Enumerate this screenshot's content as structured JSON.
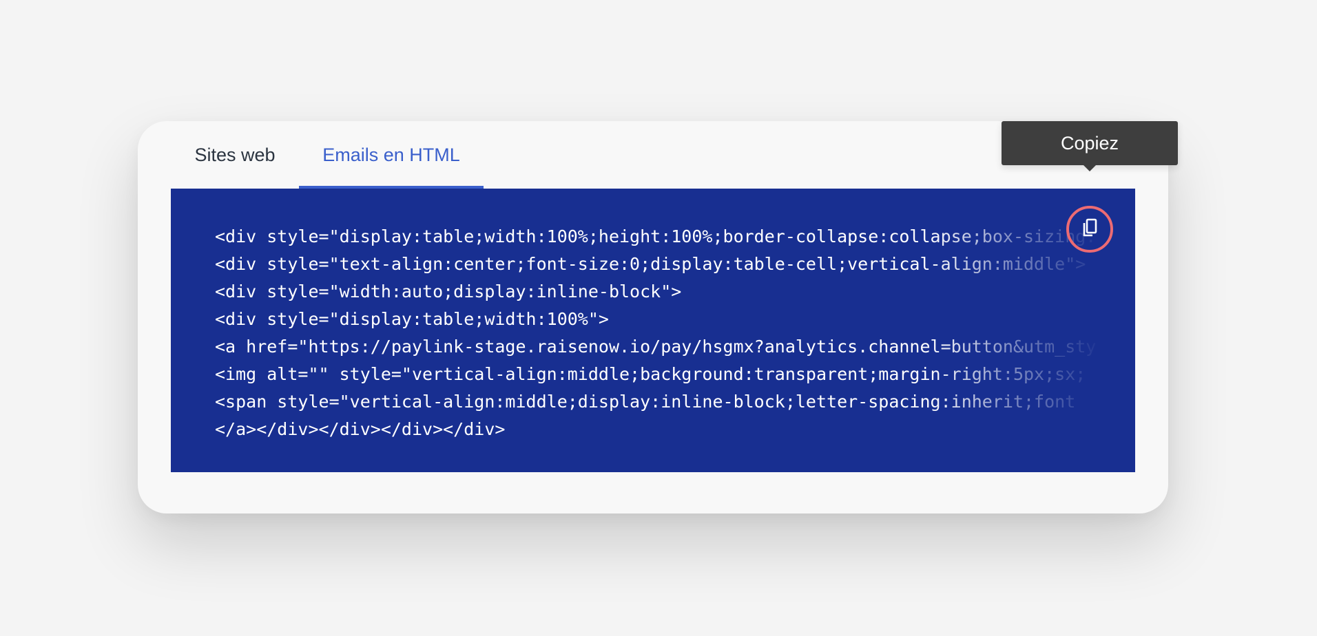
{
  "tabs": [
    {
      "label": "Sites web",
      "active": false
    },
    {
      "label": "Emails en HTML",
      "active": true
    }
  ],
  "code": {
    "lines": [
      "<div style=\"display:table;width:100%;height:100%;border-collapse:collapse;box-sizing:",
      "<div style=\"text-align:center;font-size:0;display:table-cell;vertical-align:middle\">",
      "<div style=\"width:auto;display:inline-block\">",
      "<div style=\"display:table;width:100%\">",
      "<a href=\"https://paylink-stage.raisenow.io/pay/hsgmx?analytics.channel=button&utm_sty",
      "<img alt=\"\" style=\"vertical-align:middle;background:transparent;margin-right:5px;sx;",
      "<span style=\"vertical-align:middle;display:inline-block;letter-spacing:inherit;font",
      "</a></div></div></div></div>"
    ]
  },
  "copy_button": {
    "icon": "copy-icon"
  },
  "tooltip": {
    "label": "Copiez"
  },
  "colors": {
    "background": "#f4f4f4",
    "card": "#f8f8f8",
    "code_panel": "#182f91",
    "active_tab": "#3a5fcb",
    "inactive_tab": "#2b3440",
    "tooltip": "#3e3e3e",
    "copy_ring": "#ec6b73"
  }
}
